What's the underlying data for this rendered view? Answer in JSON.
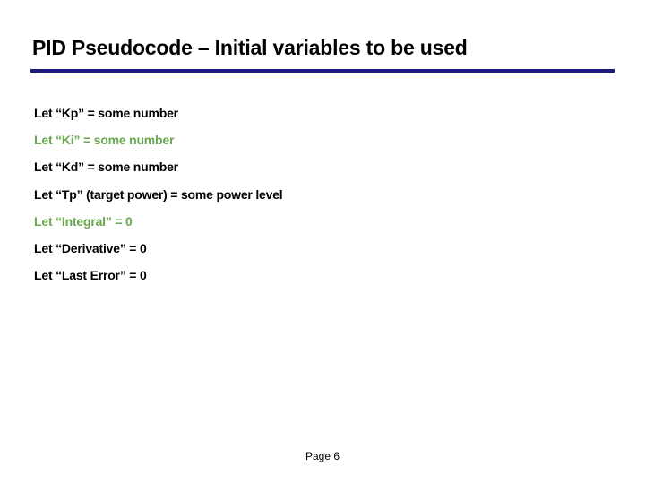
{
  "title": "PID Pseudocode – Initial variables to be used",
  "lines": {
    "l1": "Let “Kp” = some number",
    "l2": "Let “Ki” = some number",
    "l3": "Let “Kd” = some number",
    "l4": "Let “Tp” (target power) = some power level",
    "l5": "Let “Integral” = 0",
    "l6": "Let “Derivative” = 0",
    "l7": "Let “Last Error” = 0"
  },
  "pageLabel": "Page 6"
}
